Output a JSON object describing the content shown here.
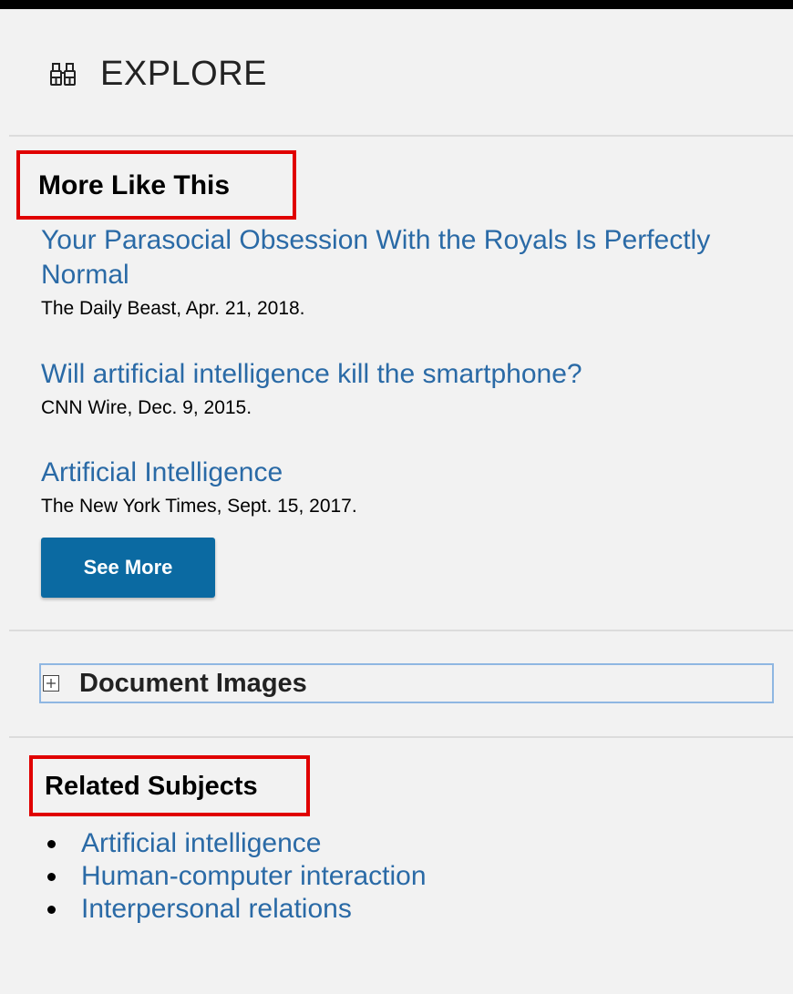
{
  "explore": {
    "title": "EXPLORE",
    "icon": "binoculars-icon"
  },
  "more_like_this": {
    "heading": "More Like This",
    "articles": [
      {
        "title": "Your Parasocial Obsession With the Royals Is Perfectly Normal",
        "source": "The Daily Beast, Apr. 21, 2018."
      },
      {
        "title": "Will artificial intelligence kill the smartphone?",
        "source": "CNN Wire, Dec. 9, 2015."
      },
      {
        "title": "Artificial Intelligence",
        "source": "The New York Times, Sept. 15, 2017."
      }
    ],
    "see_more_label": "See More"
  },
  "document_images": {
    "label": "Document Images",
    "icon": "plus-box-icon"
  },
  "related_subjects": {
    "heading": "Related Subjects",
    "items": [
      "Artificial intelligence",
      "Human-computer interaction",
      "Interpersonal relations"
    ]
  },
  "colors": {
    "link": "#2a6aa6",
    "button": "#0b6aa2",
    "highlight": "#e00000",
    "background": "#f2f2f2"
  }
}
